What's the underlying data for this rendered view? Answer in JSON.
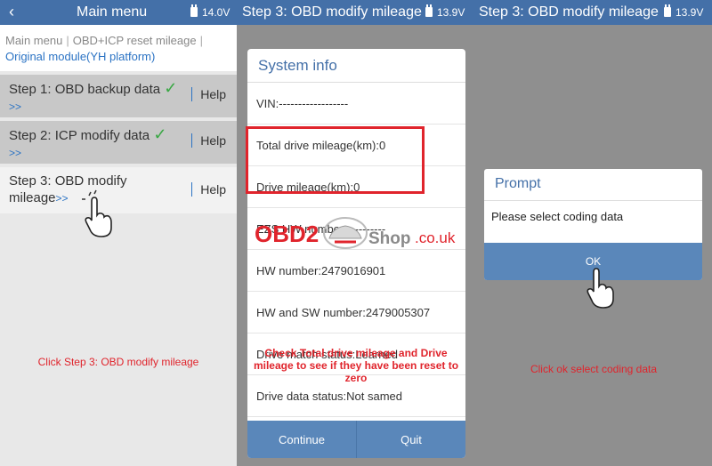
{
  "panel1": {
    "title": "Main menu",
    "voltage": "14.0V",
    "breadcrumb": [
      "Main menu",
      "OBD+ICP reset mileage",
      "Original module(YH platform)"
    ],
    "steps": [
      {
        "label": "Step 1: OBD backup data",
        "check": "✓",
        "more": ">>",
        "help": "Help"
      },
      {
        "label": "Step 2: ICP modify data",
        "check": "✓",
        "more": ">>",
        "help": "Help"
      },
      {
        "label_line1": "Step 3: OBD modify",
        "label_line2": "mileage",
        "more": ">>",
        "help": "Help"
      }
    ],
    "caption": "Click Step 3: OBD modify mileage"
  },
  "panel2": {
    "title": "Step 3: OBD modify mileage",
    "voltage": "13.9V",
    "dialog_title": "System info",
    "rows": [
      "VIN:------------------",
      "Total drive mileage(km):0",
      "Drive mileage(km):0",
      "EZS HW number:----------",
      "HW number:2479016901",
      "HW and SW number:2479005307",
      "Drive match status:Learned",
      "Drive data status:Not samed"
    ],
    "continue": "Continue",
    "quit": "Quit",
    "caption_line1": "Check Total drive mileage and Drive",
    "caption_line2": "mileage to see if they have been reset to",
    "caption_line3": "zero"
  },
  "panel3": {
    "title": "Step 3: OBD modify mileage",
    "voltage": "13.9V",
    "prompt_title": "Prompt",
    "prompt_message": "Please select coding data",
    "ok": "OK",
    "caption": "Click ok select coding data"
  },
  "watermark": {
    "obd": "OBD2",
    "shop": "Shop",
    "domain": ".co.uk"
  },
  "colors": {
    "header": "#4470a8",
    "accent_blue": "#2b73c4",
    "check_green": "#3aa845",
    "annotation_red": "#e0242c",
    "button_blue": "#5a87ba"
  }
}
